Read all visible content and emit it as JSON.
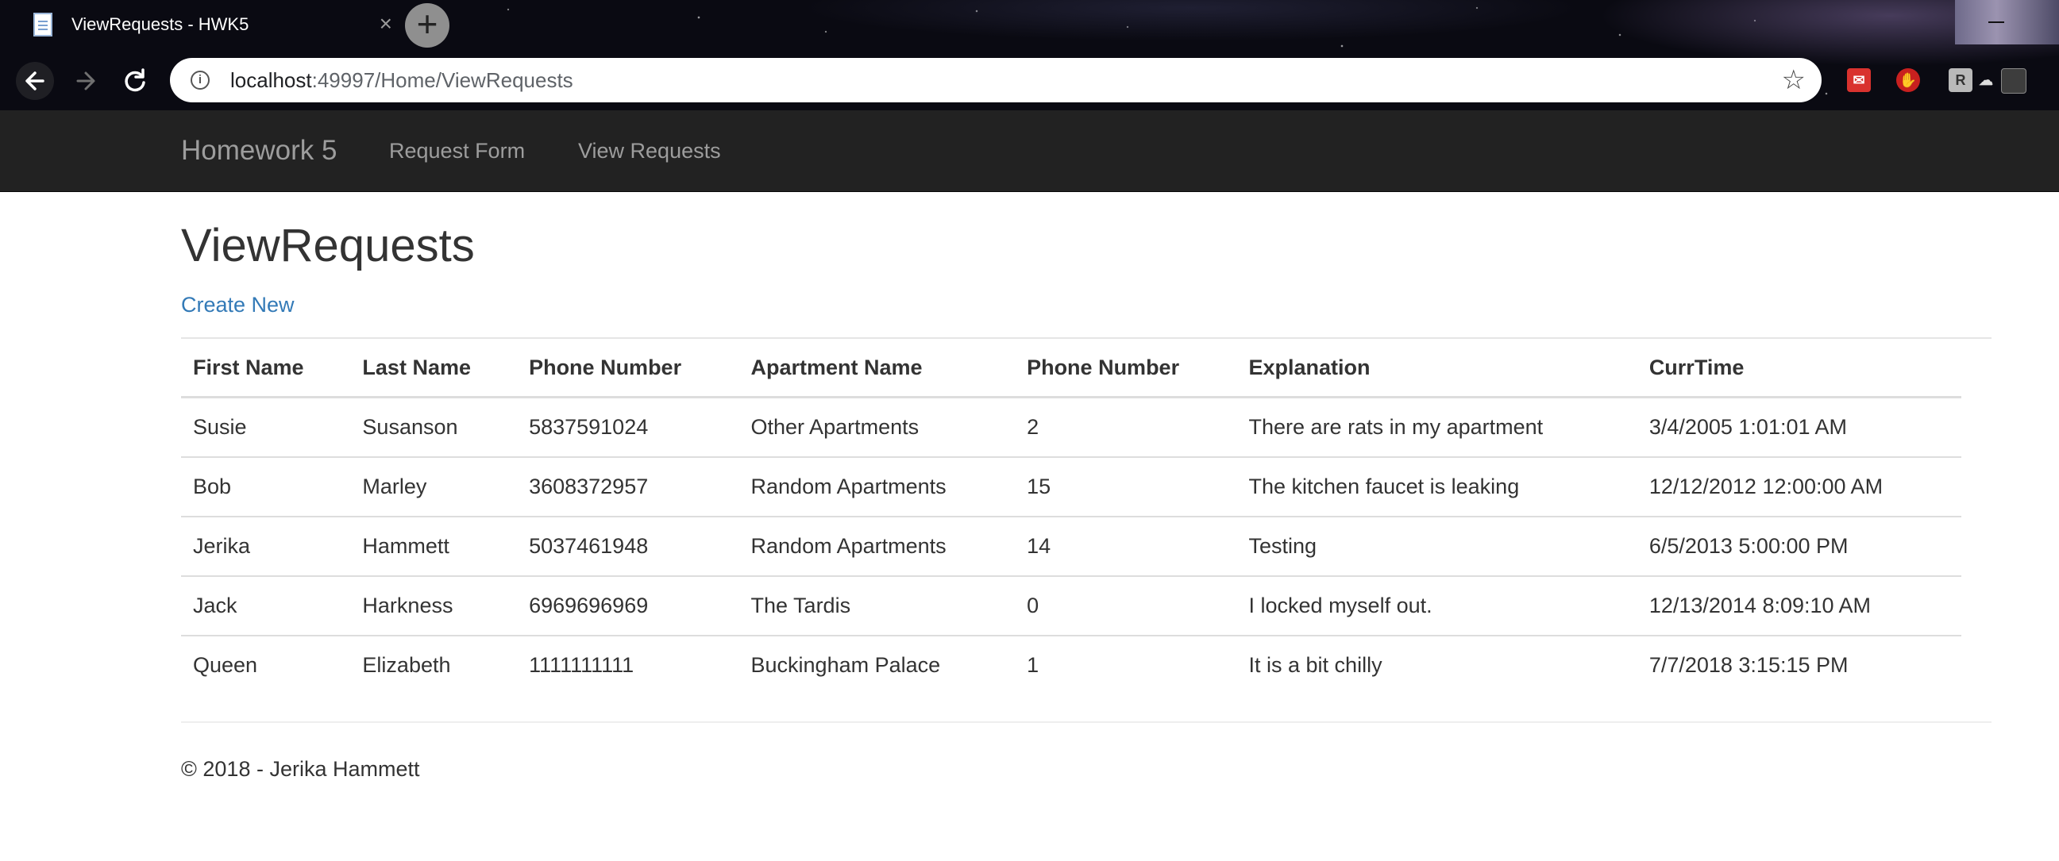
{
  "browser": {
    "tab_title": "ViewRequests - HWK5",
    "tab_close": "×",
    "new_tab": "+",
    "url_host": "localhost",
    "url_path": ":49997/Home/ViewRequests"
  },
  "icons": {
    "back": "arrow-left-icon",
    "forward": "arrow-right-icon",
    "reload": "reload-icon",
    "info": "info-icon",
    "star": "star-icon"
  },
  "navbar": {
    "brand": "Homework 5",
    "links": [
      "Request Form",
      "View Requests"
    ]
  },
  "page": {
    "title": "ViewRequests",
    "create_link": "Create New"
  },
  "table": {
    "headers": [
      "First Name",
      "Last Name",
      "Phone Number",
      "Apartment Name",
      "Phone Number",
      "Explanation",
      "CurrTime"
    ],
    "rows": [
      [
        "Susie",
        "Susanson",
        "5837591024",
        "Other Apartments",
        "2",
        "There are rats in my apartment",
        "3/4/2005 1:01:01 AM"
      ],
      [
        "Bob",
        "Marley",
        "3608372957",
        "Random Apartments",
        "15",
        "The kitchen faucet is leaking",
        "12/12/2012 12:00:00 AM"
      ],
      [
        "Jerika",
        "Hammett",
        "5037461948",
        "Random Apartments",
        "14",
        "Testing",
        "6/5/2013 5:00:00 PM"
      ],
      [
        "Jack",
        "Harkness",
        "6969696969",
        "The Tardis",
        "0",
        "I locked myself out.",
        "12/13/2014 8:09:10 AM"
      ],
      [
        "Queen",
        "Elizabeth",
        "1111111111",
        "Buckingham Palace",
        "1",
        "It is a bit chilly",
        "7/7/2018 3:15:15 PM"
      ]
    ]
  },
  "footer": {
    "text": "© 2018 - Jerika Hammett"
  },
  "colors": {
    "navbar_bg": "#222222",
    "nav_text": "#9d9d9d",
    "link": "#337ab7",
    "text": "#333333",
    "rule": "#dddddd"
  }
}
